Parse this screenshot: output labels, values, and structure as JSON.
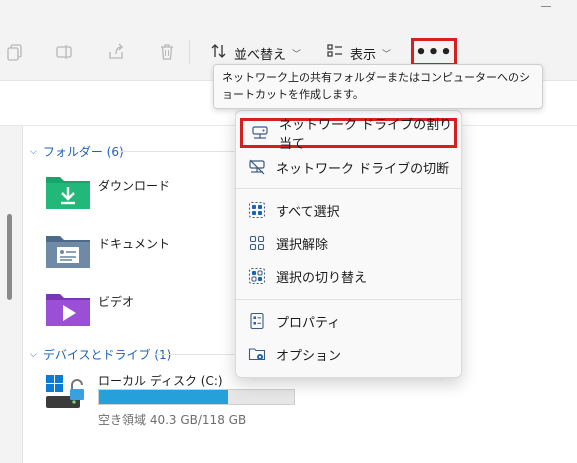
{
  "toolbar": {
    "sort_label": "並べ替え",
    "view_label": "表示",
    "more_label": "•••"
  },
  "tooltip": {
    "text": "ネットワーク上の共有フォルダーまたはコンピューターへのショートカットを作成します。"
  },
  "sections": {
    "folders": "フォルダー (6)",
    "devices": "デバイスとドライブ (1)"
  },
  "folders": [
    {
      "label": "ダウンロード",
      "icon": "download-folder-icon",
      "color": "#1aa36a"
    },
    {
      "label": "ドキュメント",
      "icon": "documents-folder-icon",
      "color": "#4d6a88"
    },
    {
      "label": "ビデオ",
      "icon": "videos-folder-icon",
      "color": "#8b43c6"
    }
  ],
  "drive": {
    "label": "ローカル ディスク (C:)",
    "free_text": "空き領域 40.3 GB/118 GB",
    "used_fraction": 0.66,
    "bar_color": "#26a0da"
  },
  "menu": {
    "items": [
      {
        "label": "ネットワーク ドライブの割り当て",
        "icon": "map-network-drive-icon",
        "highlighted": true
      },
      {
        "label": "ネットワーク ドライブの切断",
        "icon": "disconnect-network-drive-icon"
      },
      {
        "label": "すべて選択",
        "icon": "select-all-icon"
      },
      {
        "label": "選択解除",
        "icon": "select-none-icon"
      },
      {
        "label": "選択の切り替え",
        "icon": "invert-selection-icon"
      },
      {
        "label": "プロパティ",
        "icon": "properties-icon"
      },
      {
        "label": "オプション",
        "icon": "options-icon"
      }
    ]
  },
  "colors": {
    "accent_blue": "#1b63b8",
    "highlight_red": "#d52020"
  }
}
